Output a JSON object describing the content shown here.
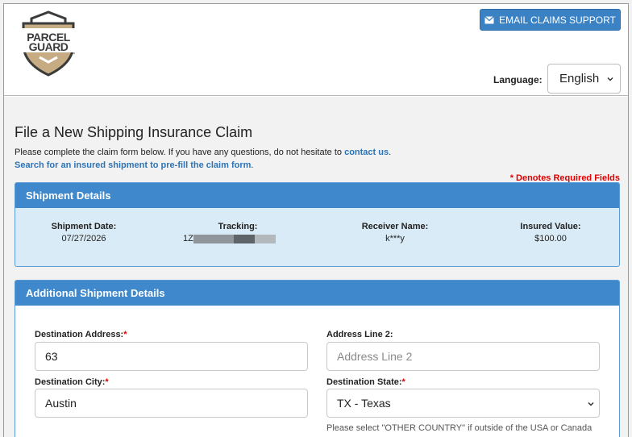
{
  "brand": {
    "line1": "PARCEL",
    "line2": "GUARD",
    "tm": "™"
  },
  "header": {
    "email_button": "EMAIL CLAIMS SUPPORT",
    "language_label": "Language:",
    "language_value": "English"
  },
  "page": {
    "title": "File a New Shipping Insurance Claim",
    "intro_text": "Please complete the claim form below. If you have any questions, do not hesitate to ",
    "contact_link": "contact us",
    "intro_end": ".",
    "search_link": "Search for an insured shipment to pre-fill the claim form",
    "search_end": ".",
    "required_note": "* Denotes Required Fields"
  },
  "shipment_details": {
    "heading": "Shipment Details",
    "date_label": "Shipment Date:",
    "date_value": "07/27/2026",
    "tracking_label": "Tracking:",
    "tracking_prefix": "1Z",
    "receiver_label": "Receiver Name:",
    "receiver_value": "k***y",
    "insured_label": "Insured Value:",
    "insured_value": "$100.00"
  },
  "additional": {
    "heading": "Additional Shipment Details",
    "dest_address_label": "Destination Address:",
    "dest_address_value": "63",
    "address2_label": "Address Line 2:",
    "address2_placeholder": "Address Line 2",
    "dest_city_label": "Destination City:",
    "dest_city_value": "Austin",
    "dest_state_label": "Destination State:",
    "dest_state_value": "TX - Texas",
    "state_help": "Please select \"OTHER COUNTRY\" if outside of the USA or Canada",
    "required_mark": "*"
  },
  "colors": {
    "accent": "#3f88cc",
    "panel_bg": "#d9ebf6",
    "required": "#e00000",
    "link": "#2b74b8"
  }
}
